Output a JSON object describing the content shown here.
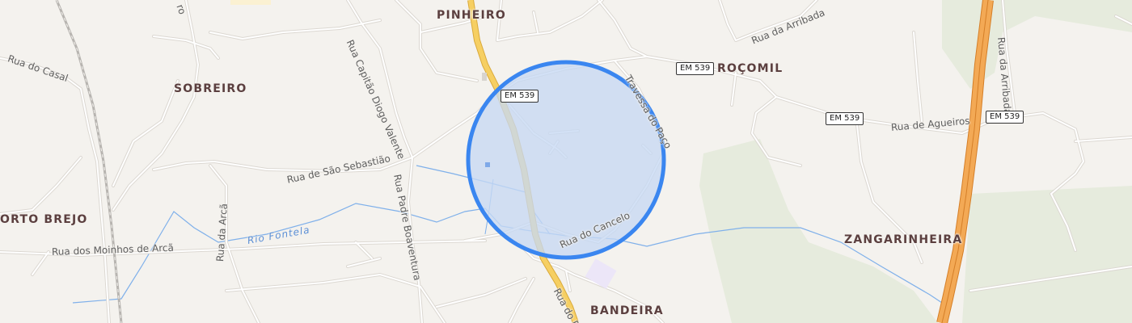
{
  "places": {
    "pinheiro": "PINHEIRO",
    "sobreiro": "SOBREIRO",
    "rocomil": "ROÇOMIL",
    "orto_brejo": "ORTO BREJO",
    "zangarinheira": "ZANGARINHEIRA",
    "bandeira": "BANDEIRA"
  },
  "streets": {
    "rua_do_casal": "Rua do Casal",
    "rua_capitao_diogo_valente": "Rua Capitão Diogo Valente",
    "rua_de_sao_sebastiao": "Rua de São Sebastião",
    "rua_padre_boaventura": "Rua Padre Boaventura",
    "rua_da_arca": "Rua da Arcã",
    "rua_dos_moinhos_de_arca": "Rua dos Moinhos de Arcã",
    "rua_do_cancelo": "Rua do Cancelo",
    "travessa_do_paco": "Travessa do Paço",
    "rua_de_agueiros": "Rua de Agueiros",
    "rua_da_arribada_top": "Rua da Arribada",
    "rua_da_arribada_vertical": "Rua da Arribada",
    "rua_do_bottom": "Rua do P",
    "rua_top_left": "ro"
  },
  "rivers": {
    "rio_fontela": "Rio Fontela"
  },
  "shields": {
    "em539_a": "EM 539",
    "em539_b": "EM 539",
    "em539_c": "EM 539",
    "em539_d": "EM 539"
  },
  "colors": {
    "background": "#f4f2ee",
    "road_casing": "#dcd8d2",
    "road_fill": "#ffffff",
    "main_road": "#f6cf62",
    "motorway": "#f3a955",
    "green_area": "#e6ebdd",
    "water": "#7fb0ea",
    "radius_fill": "#c6d8f4",
    "radius_stroke": "#3a86f0"
  }
}
